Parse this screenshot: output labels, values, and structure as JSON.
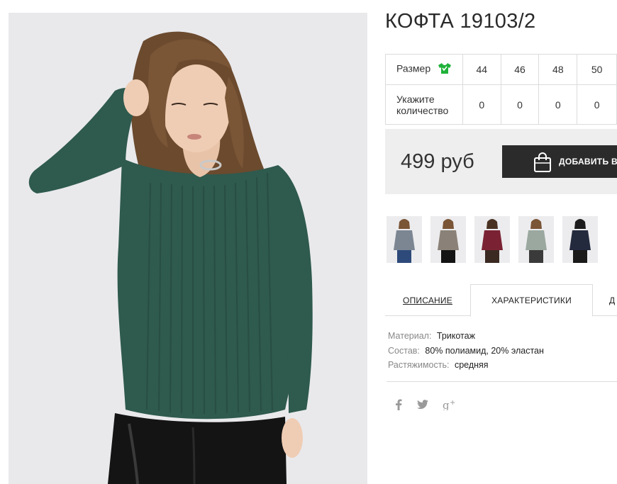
{
  "product": {
    "title": "КОФТА 19103/2"
  },
  "sizes": {
    "size_label": "Размер",
    "qty_label": "Укажите количество",
    "values": [
      "44",
      "46",
      "48",
      "50"
    ],
    "quantities": [
      "0",
      "0",
      "0",
      "0"
    ]
  },
  "purchase": {
    "price": "499 руб",
    "add_button_label": "ДОБАВИТЬ В"
  },
  "tabs": {
    "description": "ОПИСАНИЕ",
    "characteristics": "ХАРАКТЕРИСТИКИ",
    "third": "Д"
  },
  "specs": [
    {
      "key": "Материал:",
      "value": "Трикотаж"
    },
    {
      "key": "Состав:",
      "value": "80% полиамид, 20% эластан"
    },
    {
      "key": "Растяжимость:",
      "value": "средняя"
    }
  ],
  "colors": {
    "accent_green": "#1fb23a",
    "button_dark": "#2b2b2b",
    "sweater_green": "#2f5a4e",
    "thumb_colors": [
      "#7c8693",
      "#8a8278",
      "#7a2233",
      "#9aa8a0",
      "#232a3e"
    ]
  },
  "icons": [
    "shirt-icon",
    "shopping-bag-icon",
    "facebook-icon",
    "twitter-icon",
    "google-plus-icon"
  ]
}
